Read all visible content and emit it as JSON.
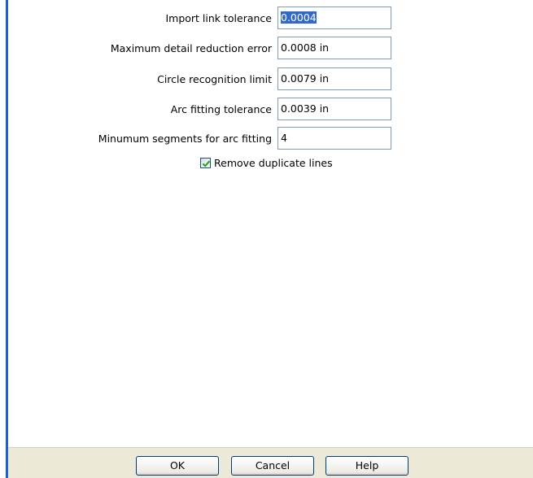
{
  "form": {
    "rows": [
      {
        "label": "Import link tolerance",
        "value": "0.0004",
        "selected": true
      },
      {
        "label": "Maximum detail reduction error",
        "value": "0.0008 in"
      },
      {
        "label": "Circle recognition limit",
        "value": "0.0079 in"
      },
      {
        "label": "Arc fitting tolerance",
        "value": "0.0039 in"
      },
      {
        "label": "Minumum segments for arc fitting",
        "value": "4"
      }
    ],
    "remove_duplicates": {
      "label": "Remove duplicate lines",
      "checked": true
    }
  },
  "buttons": {
    "ok": "OK",
    "cancel": "Cancel",
    "help": "Help"
  },
  "colors": {
    "accent": "#1f5fd6",
    "selection": "#316ac5",
    "button_bar": "#ece9d8",
    "check_mark": "#21a121"
  }
}
